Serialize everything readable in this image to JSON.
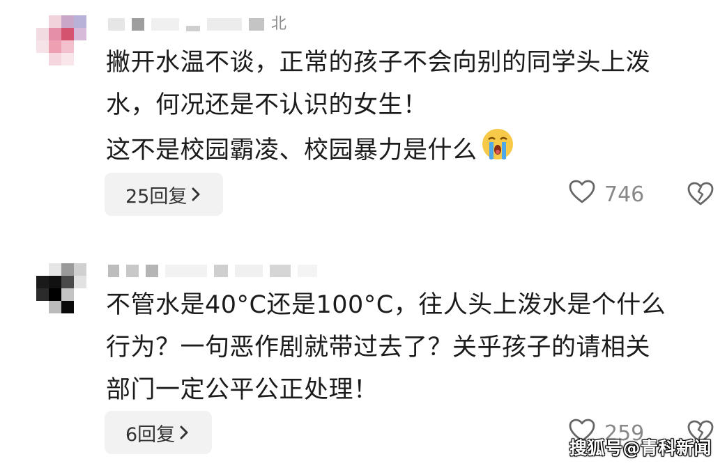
{
  "comments": [
    {
      "username_suffix": "北",
      "lines": [
        "撇开水温不谈，正常的孩子不会向别的同学头上泼",
        "水，何况还是不认识的女生！",
        "这不是校园霸凌、校园暴力是什么"
      ],
      "emoji": "crying-face-emoji",
      "replies_label": "25回复",
      "likes": "746"
    },
    {
      "username_suffix": "",
      "lines": [
        "不管水是40°C还是100°C，往人头上泼水是个什么",
        "行为？一句恶作剧就带过去了？关乎孩子的请相关",
        "部门一定公平公正处理！"
      ],
      "replies_label": "6回复",
      "likes": "259"
    }
  ],
  "watermark": "搜狐号@青科新闻",
  "colors": {
    "text": "#1b1b1b",
    "muted": "#888888",
    "reply_bg": "#f2f2f2"
  }
}
